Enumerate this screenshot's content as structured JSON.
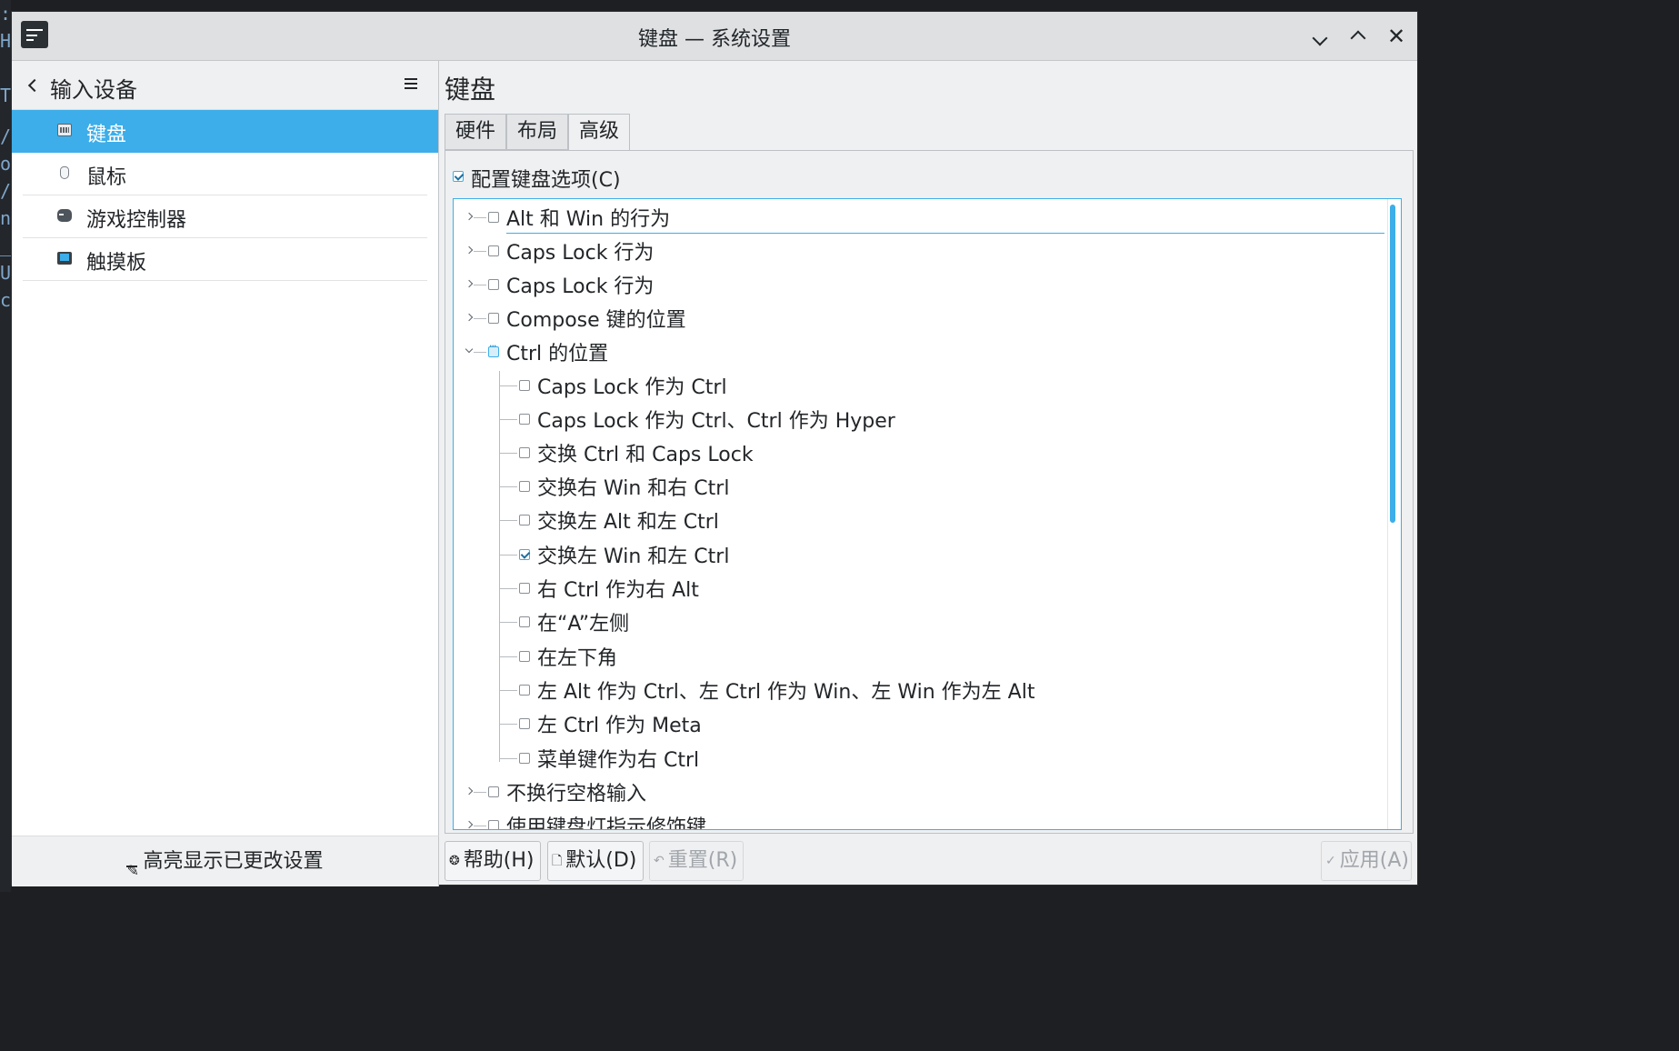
{
  "window": {
    "title": "键盘 — 系统设置"
  },
  "background_terminal": {
    "lines": [
      ":",
      "H",
      "T",
      "/",
      "o",
      "/",
      "n",
      "_",
      "U",
      "c"
    ]
  },
  "sidebar": {
    "header": {
      "title": "输入设备"
    },
    "items": [
      {
        "label": "键盘",
        "icon": "keyboard-icon",
        "active": true
      },
      {
        "label": "鼠标",
        "icon": "mouse-icon",
        "active": false
      },
      {
        "label": "游戏控制器",
        "icon": "gamepad-icon",
        "active": false
      },
      {
        "label": "触摸板",
        "icon": "touchpad-icon",
        "active": false
      }
    ],
    "highlight_button": "高亮显示已更改设置"
  },
  "main": {
    "title": "键盘",
    "tabs": [
      {
        "label": "硬件",
        "active": false
      },
      {
        "label": "布局",
        "active": false
      },
      {
        "label": "高级",
        "active": true
      }
    ],
    "configure_checkbox": {
      "label": "配置键盘选项(C)",
      "checked": true
    },
    "tree": [
      {
        "label": "Alt 和 Win 的行为",
        "level": 0,
        "expanded": false,
        "state": "unchecked"
      },
      {
        "label": "Caps Lock 行为",
        "level": 0,
        "expanded": false,
        "state": "unchecked"
      },
      {
        "label": "Caps Lock 行为",
        "level": 0,
        "expanded": false,
        "state": "unchecked"
      },
      {
        "label": "Compose 键的位置",
        "level": 0,
        "expanded": false,
        "state": "unchecked"
      },
      {
        "label": "Ctrl 的位置",
        "level": 0,
        "expanded": true,
        "state": "partial"
      },
      {
        "label": "Caps Lock 作为 Ctrl",
        "level": 1,
        "state": "unchecked"
      },
      {
        "label": "Caps Lock 作为 Ctrl、Ctrl 作为 Hyper",
        "level": 1,
        "state": "unchecked"
      },
      {
        "label": "交换 Ctrl 和 Caps Lock",
        "level": 1,
        "state": "unchecked"
      },
      {
        "label": "交换右 Win 和右 Ctrl",
        "level": 1,
        "state": "unchecked"
      },
      {
        "label": "交换左 Alt 和左 Ctrl",
        "level": 1,
        "state": "unchecked"
      },
      {
        "label": "交换左 Win 和左 Ctrl",
        "level": 1,
        "state": "checked"
      },
      {
        "label": "右 Ctrl 作为右 Alt",
        "level": 1,
        "state": "unchecked"
      },
      {
        "label": "在“A”左侧",
        "level": 1,
        "state": "unchecked"
      },
      {
        "label": "在左下角",
        "level": 1,
        "state": "unchecked"
      },
      {
        "label": "左 Alt 作为 Ctrl、左 Ctrl 作为 Win、左 Win 作为左 Alt",
        "level": 1,
        "state": "unchecked"
      },
      {
        "label": "左 Ctrl 作为 Meta",
        "level": 1,
        "state": "unchecked"
      },
      {
        "label": "菜单键作为右 Ctrl",
        "level": 1,
        "state": "unchecked"
      },
      {
        "label": "不换行空格输入",
        "level": 0,
        "expanded": false,
        "state": "unchecked"
      },
      {
        "label": "使用键盘灯指示修饰键",
        "level": 0,
        "expanded": false,
        "state": "unchecked"
      }
    ]
  },
  "buttons": {
    "help": "帮助(H)",
    "defaults": "默认(D)",
    "reset": "重置(R)",
    "apply": "应用(A)"
  },
  "colors": {
    "accent": "#3daee9",
    "window_bg": "#eff0f1",
    "text": "#232629",
    "disabled_text": "#a2a6ab"
  }
}
